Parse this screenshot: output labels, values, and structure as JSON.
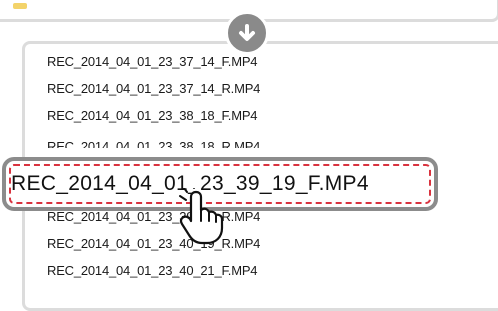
{
  "files": {
    "rows": [
      "REC_2014_04_01_23_37_14_F.MP4",
      "REC_2014_04_01_23_37_14_R.MP4",
      "REC_2014_04_01_23_38_18_F.MP4",
      "REC_2014_04_01_23_38_18_R.MP4",
      "REC_2014_04_01_23_39_19_R.MP4",
      "REC_2014_04_01_23_40_19_R.MP4",
      "REC_2014_04_01_23_40_21_F.MP4"
    ],
    "selected": "REC_2014_04_01_23_39_19_F.MP4"
  },
  "icons": {
    "arrow": "arrow-down-icon",
    "cursor": "hand-pointer-icon",
    "folder": "folder-icon"
  },
  "colors": {
    "highlight_border": "#8c8c8c",
    "dashed_selection": "#d9333f",
    "arrow_badge": "#8a8a8a"
  }
}
